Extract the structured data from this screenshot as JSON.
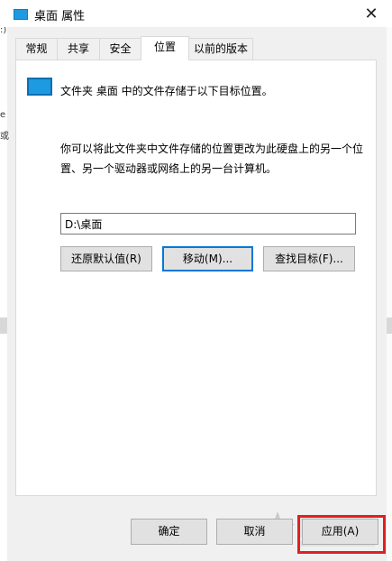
{
  "window": {
    "title": "桌面 属性",
    "close_glyph": "✕"
  },
  "background": {
    "fragments": [
      ":)",
      "e",
      "或"
    ]
  },
  "tabs": [
    {
      "label": "常规"
    },
    {
      "label": "共享"
    },
    {
      "label": "安全"
    },
    {
      "label": "位置",
      "active": true
    },
    {
      "label": "以前的版本"
    }
  ],
  "location": {
    "info": "文件夹 桌面 中的文件存储于以下目标位置。",
    "description": "你可以将此文件夹中文件存储的位置更改为此硬盘上的另一个位置、另一个驱动器或网络上的另一台计算机。",
    "path_value": "D:\\桌面",
    "buttons": {
      "restore": "还原默认值(R)",
      "move": "移动(M)...",
      "find": "查找目标(F)..."
    }
  },
  "footer": {
    "ok": "确定",
    "cancel": "取消",
    "apply": "应用(A)"
  },
  "icons": {
    "title": "folder-icon",
    "close": "close-icon",
    "folder": "folder-icon"
  },
  "colors": {
    "accent": "#0078d7",
    "folder_blue": "#1e9ae0",
    "highlight": "#e02020"
  }
}
